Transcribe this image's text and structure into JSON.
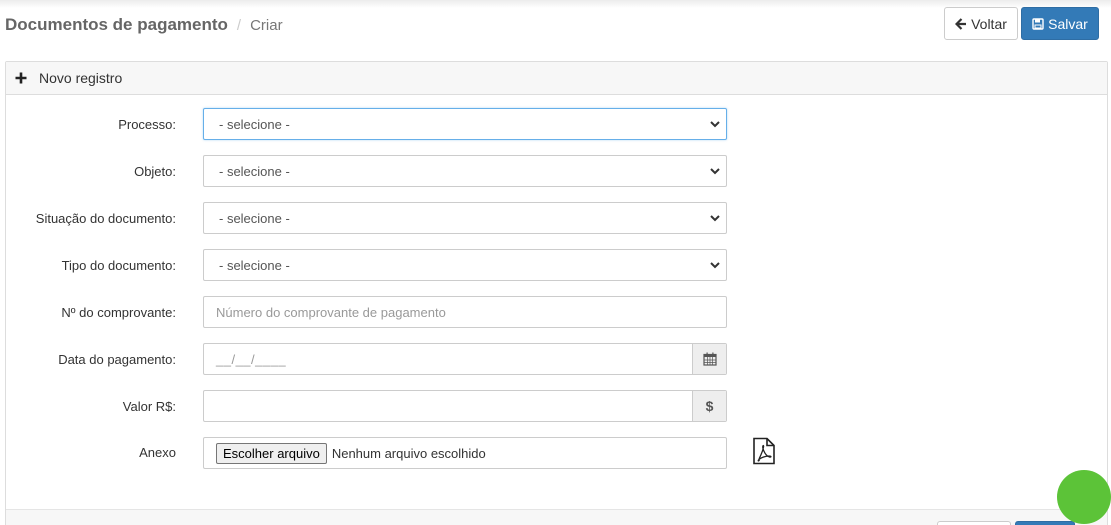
{
  "header": {
    "title": "Documentos de pagamento",
    "separator": "/",
    "current": "Criar",
    "back_label": "Voltar",
    "save_label": "Salvar"
  },
  "panel": {
    "title": "Novo registro"
  },
  "form": {
    "processo": {
      "label": "Processo:",
      "value": "- selecione -"
    },
    "objeto": {
      "label": "Objeto:",
      "value": "- selecione -"
    },
    "situacao": {
      "label": "Situação do documento:",
      "value": "- selecione -"
    },
    "tipo": {
      "label": "Tipo do documento:",
      "value": "- selecione -"
    },
    "comprovante": {
      "label": "Nº do comprovante:",
      "placeholder": "Número do comprovante de pagamento"
    },
    "data": {
      "label": "Data do pagamento:",
      "mask": "__/__/____"
    },
    "valor": {
      "label": "Valor R$:",
      "addon": "$"
    },
    "anexo": {
      "label": "Anexo",
      "button": "Escolher arquivo",
      "status": "Nenhum arquivo escolhido"
    }
  },
  "colors": {
    "primary": "#337ab7",
    "focus": "#66afe9",
    "accent_dot": "#5cc338"
  },
  "icons": [
    "arrow-left-icon",
    "save-icon",
    "plus-icon",
    "chevron-down-icon",
    "calendar-icon",
    "pdf-file-icon"
  ]
}
